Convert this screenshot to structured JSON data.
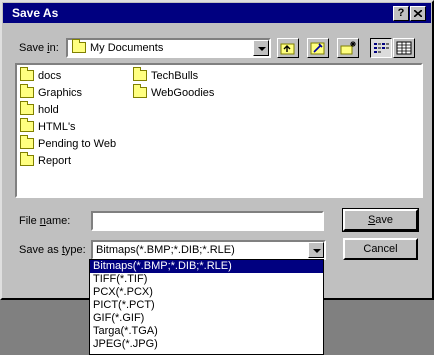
{
  "window": {
    "title": "Save As",
    "help_button": "?",
    "close_button": "x"
  },
  "save_in": {
    "label_pre": "Save ",
    "label_ul": "i",
    "label_post": "n:",
    "value": "My Documents"
  },
  "toolbar": [
    {
      "name": "up-one-level-button",
      "icon": "folder-up-icon"
    },
    {
      "name": "look-in-favorites-button",
      "icon": "favorites-icon"
    },
    {
      "name": "create-new-folder-button",
      "icon": "new-folder-icon"
    },
    {
      "name": "list-view-button",
      "icon": "list-icon",
      "pressed": true
    },
    {
      "name": "details-view-button",
      "icon": "details-icon"
    }
  ],
  "folders": {
    "col1": [
      "docs",
      "Graphics",
      "hold",
      "HTML's",
      "Pending to Web",
      "Report"
    ],
    "col2": [
      "TechBulls",
      "WebGoodies"
    ]
  },
  "file_name": {
    "label_pre": "File ",
    "label_ul": "n",
    "label_post": "ame:",
    "value": ""
  },
  "save_as_type": {
    "label_pre": "Save as ",
    "label_ul": "t",
    "label_post": "ype:",
    "value": "Bitmaps(*.BMP;*.DIB;*.RLE)",
    "options": [
      "Bitmaps(*.BMP;*.DIB;*.RLE)",
      "TIFF(*.TIF)",
      "PCX(*.PCX)",
      "PICT(*.PCT)",
      "GIF(*.GIF)",
      "Targa(*.TGA)",
      "JPEG(*.JPG)"
    ],
    "selected_index": 0
  },
  "buttons": {
    "save_ul": "S",
    "save_rest": "ave",
    "cancel": "Cancel"
  },
  "colors": {
    "titlebar": "#000080",
    "face": "#c0c0c0",
    "selection": "#000080",
    "folder": "#ffff80"
  }
}
